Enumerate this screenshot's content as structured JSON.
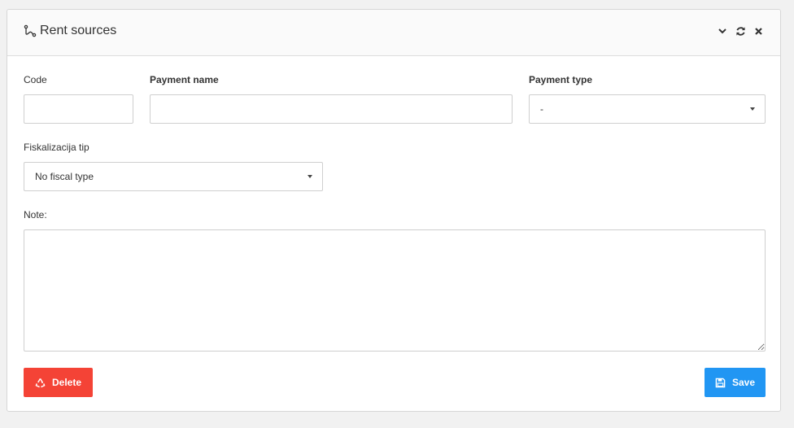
{
  "window": {
    "title": "Rent sources",
    "title_icon": "route-icon",
    "tools": [
      "chevron-down-icon",
      "refresh-icon",
      "close-icon"
    ]
  },
  "form": {
    "code": {
      "label": "Code",
      "value": ""
    },
    "payment_name": {
      "label": "Payment name",
      "value": ""
    },
    "payment_type": {
      "label": "Payment type",
      "selected": "-"
    },
    "fiscal_type": {
      "label": "Fiskalizacija tip",
      "selected": "No fiscal type"
    },
    "note": {
      "label": "Note:",
      "value": ""
    }
  },
  "actions": {
    "delete_label": "Delete",
    "save_label": "Save"
  },
  "colors": {
    "delete": "#f44336",
    "save": "#2196f3",
    "background": "#f1f1f1"
  }
}
